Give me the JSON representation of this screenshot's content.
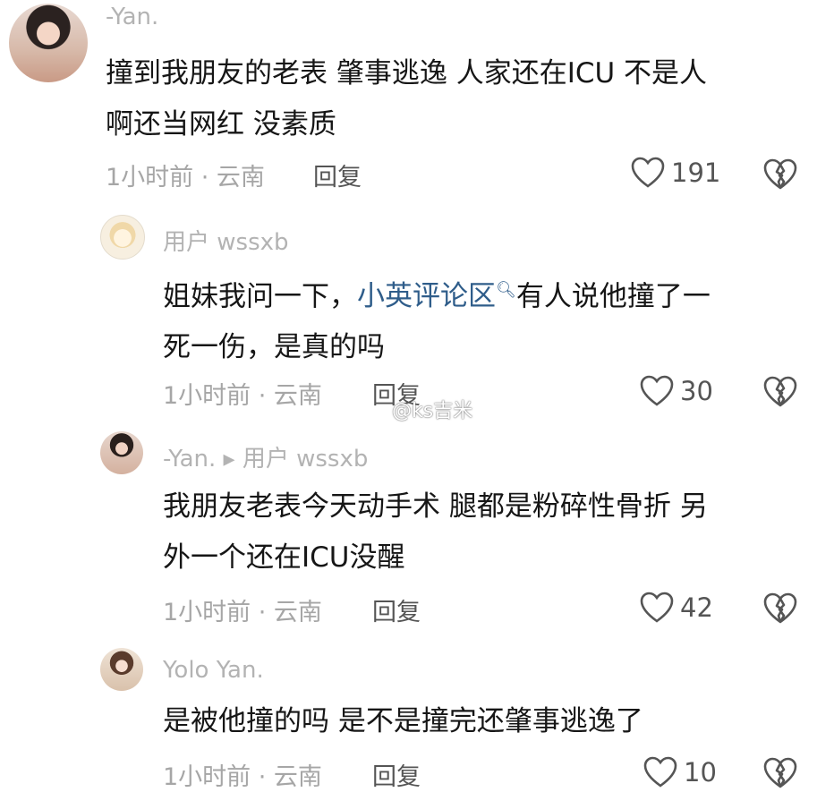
{
  "comments": [
    {
      "username": "-Yan.",
      "lines": [
        "撞到我朋友的老表 肇事逃逸 人家还在ICU 不是人",
        "啊还当网红 没素质"
      ],
      "time_location": "1小时前 · 云南",
      "reply_label": "回复",
      "likes": "191"
    },
    {
      "username": "用户 wssxb",
      "line1_before": "姐妹我问一下，",
      "mention": "小英评论区",
      "line1_after": "有人说他撞了一",
      "line2": "死一伤，是真的吗",
      "time_location": "1小时前 · 云南",
      "reply_label": "回复",
      "likes": "30"
    },
    {
      "username": "-Yan. ▸ 用户 wssxb",
      "lines": [
        "我朋友老表今天动手术 腿都是粉碎性骨折 另",
        "外一个还在ICU没醒"
      ],
      "time_location": "1小时前 · 云南",
      "reply_label": "回复",
      "likes": "42"
    },
    {
      "username": "Yolo     Yan.",
      "lines": [
        "是被他撞的吗 是不是撞完还肇事逃逸了"
      ],
      "time_location": "1小时前 · 云南",
      "reply_label": "回复",
      "likes": "10"
    }
  ],
  "watermark": "@ks吉米",
  "icons": {
    "like": "heart-outline-icon",
    "dislike": "broken-heart-icon",
    "search": "search-icon"
  }
}
